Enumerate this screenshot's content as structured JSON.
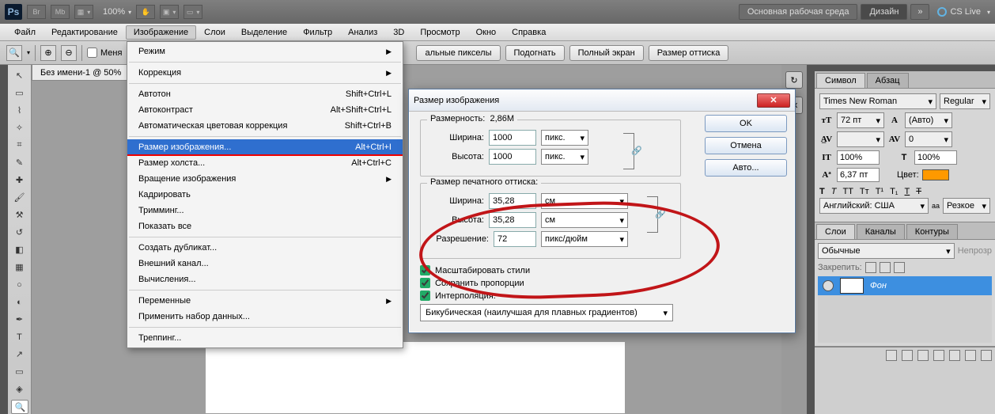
{
  "top": {
    "ps": "Ps",
    "br": "Br",
    "mb": "Mb",
    "zoom": "100%",
    "workspace_default": "Основная рабочая среда",
    "design": "Дизайн",
    "more": "»",
    "cslive": "CS Live"
  },
  "menu": {
    "items": [
      "Файл",
      "Редактирование",
      "Изображение",
      "Слои",
      "Выделение",
      "Фильтр",
      "Анализ",
      "3D",
      "Просмотр",
      "Окно",
      "Справка"
    ],
    "active_index": 2
  },
  "options": {
    "checkbox_label": "Меня",
    "btn_real_pixels": "альные пикселы",
    "btn_fit": "Подогнать",
    "btn_fullscreen": "Полный экран",
    "btn_print_size": "Размер оттиска"
  },
  "doc_tab": {
    "title": "Без имени-1 @ 50%",
    "close": "×"
  },
  "dropdown": {
    "items": [
      {
        "label": "Режим",
        "arrow": true
      },
      {
        "sep": true
      },
      {
        "label": "Коррекция",
        "arrow": true
      },
      {
        "sep": true
      },
      {
        "label": "Автотон",
        "shortcut": "Shift+Ctrl+L"
      },
      {
        "label": "Автоконтраст",
        "shortcut": "Alt+Shift+Ctrl+L"
      },
      {
        "label": "Автоматическая цветовая коррекция",
        "shortcut": "Shift+Ctrl+B"
      },
      {
        "sep": true
      },
      {
        "label": "Размер изображения...",
        "shortcut": "Alt+Ctrl+I",
        "highlight": true
      },
      {
        "label": "Размер холста...",
        "shortcut": "Alt+Ctrl+C"
      },
      {
        "label": "Вращение изображения",
        "arrow": true
      },
      {
        "label": "Кадрировать"
      },
      {
        "label": "Тримминг..."
      },
      {
        "label": "Показать все"
      },
      {
        "sep": true
      },
      {
        "label": "Создать дубликат..."
      },
      {
        "label": "Внешний канал..."
      },
      {
        "label": "Вычисления..."
      },
      {
        "sep": true
      },
      {
        "label": "Переменные",
        "arrow": true
      },
      {
        "label": "Применить набор данных..."
      },
      {
        "sep": true
      },
      {
        "label": "Треппинг..."
      }
    ]
  },
  "dialog": {
    "title": "Размер изображения",
    "dim_label": "Размерность:",
    "dim_value": "2,86M",
    "pixel_group": {
      "width_label": "Ширина:",
      "width_value": "1000",
      "width_unit": "пикс.",
      "height_label": "Высота:",
      "height_value": "1000",
      "height_unit": "пикс."
    },
    "print_group": {
      "legend": "Размер печатного оттиска:",
      "width_label": "Ширина:",
      "width_value": "35,28",
      "width_unit": "см",
      "height_label": "Высота:",
      "height_value": "35,28",
      "height_unit": "см",
      "res_label": "Разрешение:",
      "res_value": "72",
      "res_unit": "пикс/дюйм"
    },
    "chk_scale": "Масштабировать стили",
    "chk_prop": "Сохранить пропорции",
    "chk_interp": "Интерполяция:",
    "interp_value": "Бикубическая (наилучшая для плавных градиентов)",
    "btn_ok": "OK",
    "btn_cancel": "Отмена",
    "btn_auto": "Авто..."
  },
  "panels": {
    "char": {
      "tab_symbol": "Символ",
      "tab_para": "Абзац",
      "font": "Times New Roman",
      "style": "Regular",
      "size": "72 пт",
      "leading": "(Авто)",
      "tracking": "0",
      "vscale": "100%",
      "hscale": "100%",
      "baseline": "6,37 пт",
      "color_label": "Цвет:",
      "lang": "Английский: США",
      "aa": "Резкое"
    },
    "layers": {
      "tab_layers": "Слои",
      "tab_channels": "Каналы",
      "tab_paths": "Контуры",
      "blend": "Обычные",
      "opacity_label": "Непрозр",
      "lock_label": "Закрепить:",
      "layer_name": "Фон"
    }
  },
  "chart_data": null
}
